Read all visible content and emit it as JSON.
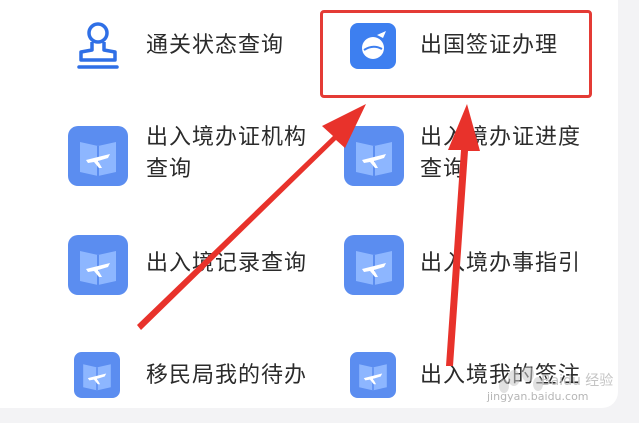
{
  "menu": {
    "items": [
      {
        "label_lines": [
          "通关状态查询"
        ],
        "icon": "stamp-icon"
      },
      {
        "label_lines": [
          "出国签证办理"
        ],
        "icon": "globe-plane-icon",
        "highlighted": true
      },
      {
        "label_lines": [
          "出入境办证机构",
          "查询"
        ],
        "icon": "book-plane-icon"
      },
      {
        "label_lines": [
          "出入境办证进度",
          "查询"
        ],
        "icon": "book-plane-icon"
      },
      {
        "label_lines": [
          "出入境记录查询"
        ],
        "icon": "book-plane-icon"
      },
      {
        "label_lines": [
          "出入境办事指引"
        ],
        "icon": "book-plane-icon"
      },
      {
        "label_lines": [
          "移民局我的待办"
        ],
        "icon": "book-plane-icon"
      },
      {
        "label_lines": [
          "出入境我的签注"
        ],
        "icon": "book-plane-icon"
      }
    ]
  },
  "annotation": {
    "highlight_color": "#e43b35",
    "arrow_color": "#e8322b"
  },
  "watermark": {
    "brand": "Baidu 经验",
    "url": "jingyan.baidu.com"
  }
}
